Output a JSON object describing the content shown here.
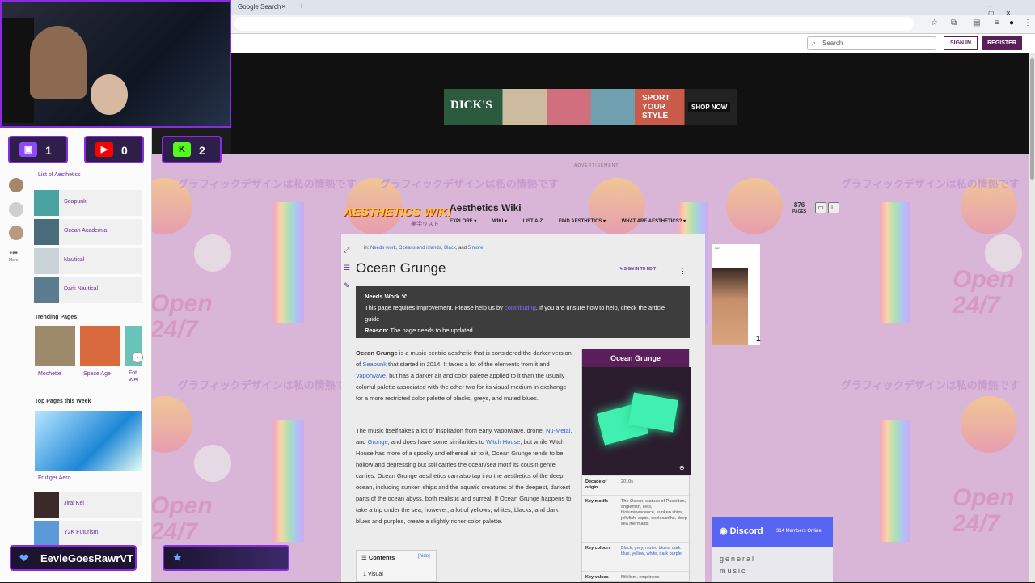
{
  "browser": {
    "tab_title": "Google Search",
    "tab_close": "×",
    "new_tab": "+"
  },
  "wiki_topbar": {
    "search_placeholder": "Search",
    "sign_in": "SIGN IN",
    "register": "REGISTER"
  },
  "ad_banner": {
    "brand": "DICK'S",
    "slogan": "SPORT YOUR STYLE",
    "cta": "SHOP NOW",
    "label": "ADVERTISEMENT"
  },
  "background_text": "グラフィックデザインは私の情熱です",
  "background_open": "Open 24/7",
  "wiki_header": {
    "logo": "AESTHETICS WIKI",
    "logo_sub": "美学リスト",
    "title": "Aesthetics Wiki",
    "nav": [
      "EXPLORE ▾",
      "WIKI ▾",
      "LIST A-Z",
      "FIND AESTHETICS ▾",
      "WHAT ARE AESTHETICS? ▾"
    ],
    "pages_count": "876",
    "pages_label": "PAGES"
  },
  "article": {
    "categories_prefix": "in:",
    "categories": [
      "Needs work",
      "Oceans and islands",
      "Black"
    ],
    "categories_more": "5 more",
    "title": "Ocean Grunge",
    "edit": "SIGN IN TO EDIT",
    "notice": {
      "heading": "Needs Work",
      "line1": "This page requires improvement. Please help us by",
      "link1": "contributing",
      "line2": ". If you are unsure how to help, check the article guide",
      "link2": "article guide",
      "reason_label": "Reason:",
      "reason": "The page needs to be updated."
    },
    "p1": {
      "bold": "Ocean Grunge",
      "t1": " is a music-centric aesthetic that is considered the darker version of ",
      "l1": "Seapunk",
      "t2": " that started in 2014. It takes a lot of the elements from it and ",
      "l2": "Vaporwave",
      "t3": ", but has a darker air and color palette applied to it than the usually colorful palette associated with the other two for its visual medium in exchange for a more restricted color palette of blacks, greys, and muted blues."
    },
    "p2": {
      "t1": "The music itself takes a lot of inspiration from early Vaporwave, drone, ",
      "l1": "Nu-Metal",
      "t2": ", and ",
      "l2": "Grunge",
      "t3": ", and does have some similarities to ",
      "l3": "Witch House",
      "t4": ", but while Witch House has more of a spooky and ethereal air to it, Ocean Grunge tends to be hollow and depressing but still carries the ocean/sea motif its cousin genre carries. Ocean Grunge aesthetics can also tap into the aesthetics of the deep ocean, including sunken ships and the aquatic creatures of the deepest, darkest parts of the ocean abyss, both realistic and surreal. If Ocean Grunge happens to take a trip under the sea, however, a lot of yellows, whites, blacks, and dark blues and purples, create a slightly richer color palette."
    },
    "toc": {
      "title": "Contents",
      "hide": "[hide]",
      "first": "1   Visual"
    }
  },
  "infobox": {
    "title": "Ocean Grunge",
    "rows": [
      {
        "key": "Decade of origin",
        "value": "2010s"
      },
      {
        "key": "Key motifs",
        "value": "The Ocean, statues of Poseidon, anglerfish, eels, bioluminescence, sunken ships, jellyfish, squid, coelacanths, deep sea mermaids"
      },
      {
        "key": "Key colours",
        "value": "Black, grey, muted blues, dark blue, yellow, white, dark purple"
      },
      {
        "key": "Key values",
        "value": "Nihilism, emptiness"
      }
    ]
  },
  "rail": {
    "ad_tag": "AD",
    "ad_number": "1",
    "discord_label": "Discord",
    "discord_members": "314 Members Online",
    "discord_channels": [
      "general",
      "music"
    ]
  },
  "sidebar": {
    "list_link": "List of Aesthetics",
    "more": "More",
    "items": [
      {
        "label": "Seapunk",
        "color": "#4aa3a0"
      },
      {
        "label": "Ocean Academia",
        "color": "#4a6c7a"
      },
      {
        "label": "Nautical",
        "color": "#c9d3d8"
      },
      {
        "label": "Dark Nautical",
        "color": "#5b7c8f"
      }
    ],
    "trending_title": "Trending Pages",
    "trending": [
      {
        "label": "Mochette",
        "color": "#9d8a6b"
      },
      {
        "label": "Space Age",
        "color": "#d86a3d"
      },
      {
        "label": "Fot Wel",
        "color": "#6ac3b8"
      }
    ],
    "next": "›",
    "top_title": "Top Pages this Week",
    "top_big": "Frutiger Aero",
    "top_items": [
      {
        "label": "Jirai Kei",
        "color": "#3a2a2a"
      },
      {
        "label": "Y2K Futurism",
        "color": "#5a9ad8"
      }
    ]
  },
  "stream_overlay": {
    "twitch_count": "1",
    "youtube_count": "0",
    "kick_count": "2",
    "kick_label": "K",
    "name": "EevieGoesRawrVT"
  }
}
